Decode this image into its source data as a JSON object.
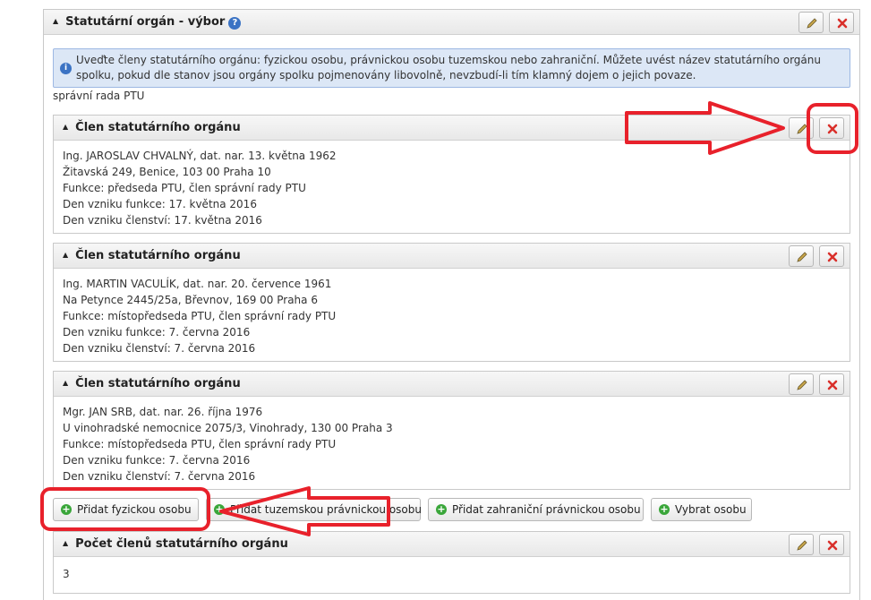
{
  "section": {
    "title": "Statutární orgán - výbor",
    "info": "Uveďte členy statutárního orgánu: fyzickou osobu, právnickou osobu tuzemskou nebo zahraniční. Můžete uvést název statutárního orgánu spolku, pokud dle stanov jsou orgány spolku pojmenovány libovolně, nevzbudí-li tím klamný dojem o jejich povaze.",
    "organ_name": "správní rada PTU"
  },
  "members": [
    {
      "title": "Člen statutárního orgánu",
      "lines": [
        "Ing. JAROSLAV CHVALNÝ, dat. nar. 13. května 1962",
        "Žitavská 249, Benice, 103 00 Praha 10",
        "Funkce: předseda PTU, člen správní rady PTU",
        "Den vzniku funkce: 17. května 2016",
        "Den vzniku členství: 17. května 2016"
      ]
    },
    {
      "title": "Člen statutárního orgánu",
      "lines": [
        "Ing. MARTIN VACULÍK, dat. nar. 20. července 1961",
        "Na Petynce 2445/25a, Břevnov, 169 00 Praha 6",
        "Funkce: místopředseda PTU, člen správní rady PTU",
        "Den vzniku funkce: 7. června 2016",
        "Den vzniku členství: 7. června 2016"
      ]
    },
    {
      "title": "Člen statutárního orgánu",
      "lines": [
        "Mgr. JAN SRB, dat. nar. 26. října 1976",
        "U vinohradské nemocnice 2075/3, Vinohrady, 130 00 Praha 3",
        "Funkce: místopředseda PTU, člen správní rady PTU",
        "Den vzniku funkce: 7. června 2016",
        "Den vzniku členství: 7. června 2016"
      ]
    }
  ],
  "actions": {
    "add_person": "Přidat fyzickou osobu",
    "add_domestic": "Přidat tuzemskou právnickou osobu",
    "add_foreign": "Přidat zahraniční právnickou osobu",
    "select_person": "Vybrat osobu"
  },
  "count_panel": {
    "title": "Počet členů statutárního orgánu",
    "value": "3"
  },
  "icons": {
    "edit": "pencil-icon",
    "delete": "close-icon",
    "add": "plus-circle-icon",
    "collapse": "caret-up-icon",
    "help": "help-icon",
    "info": "info-icon"
  },
  "colors": {
    "annotation": "#e8212b",
    "delete": "#d9302b",
    "add": "#3aa63a",
    "info_bg": "#dce7f6"
  }
}
